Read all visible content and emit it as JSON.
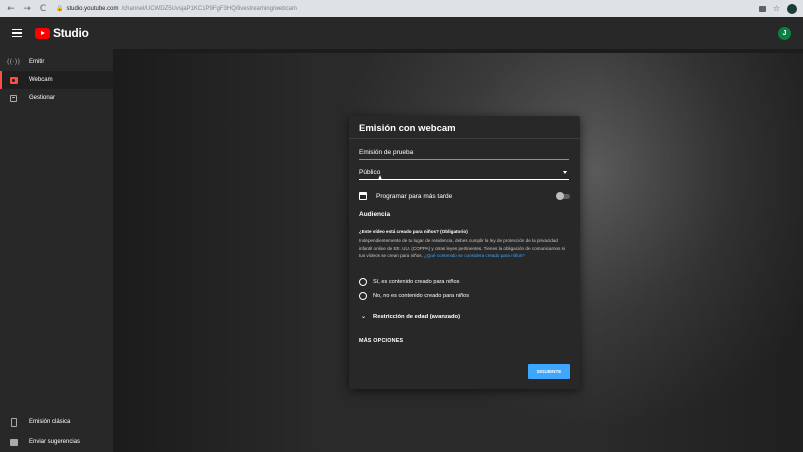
{
  "browser": {
    "back": "←",
    "forward": "→",
    "reload": "C",
    "url_host": "studio.youtube.com",
    "url_path": "/channel/UCWDZ5UvsjaP1KC1P9FgF3HQ/livestreaming/webcam",
    "star": "☆"
  },
  "header": {
    "logo_text": "Studio",
    "avatar_initial": "J"
  },
  "sidebar": {
    "items": [
      {
        "label": "Emitir"
      },
      {
        "label": "Webcam"
      },
      {
        "label": "Gestionar"
      }
    ],
    "bottom_items": [
      {
        "label": "Emisión clásica"
      },
      {
        "label": "Enviar sugerencias"
      }
    ]
  },
  "dialog": {
    "title": "Emisión con webcam",
    "title_field_value": "Emisión de prueba",
    "visibility_value": "Público",
    "schedule_label": "Programar para más tarde",
    "audience_heading": "Audiencia",
    "kids_question": "¿Este vídeo está creado para niños? (Obligatorio)",
    "kids_description": "Independientemente de tu lugar de residencia, debes cumplir la ley de protección de la privacidad infantil online de EE. UU. (COPPA) y otras leyes pertinentes. Tienes la obligación de comunicarnos si tus vídeos se crean para niños.",
    "kids_link": "¿Qué contenido se considera creado para niños?",
    "radio_yes": "Sí, es contenido creado para niños",
    "radio_no": "No, no es contenido creado para niños",
    "age_restriction": "Restricción de edad (avanzado)",
    "more_options": "MÁS OPCIONES",
    "next_button": "SIGUIENTE"
  },
  "colors": {
    "accent": "#3ea6ff",
    "brand": "#ff0000",
    "active_indicator": "#ff4e45",
    "avatar": "#0b8043"
  }
}
